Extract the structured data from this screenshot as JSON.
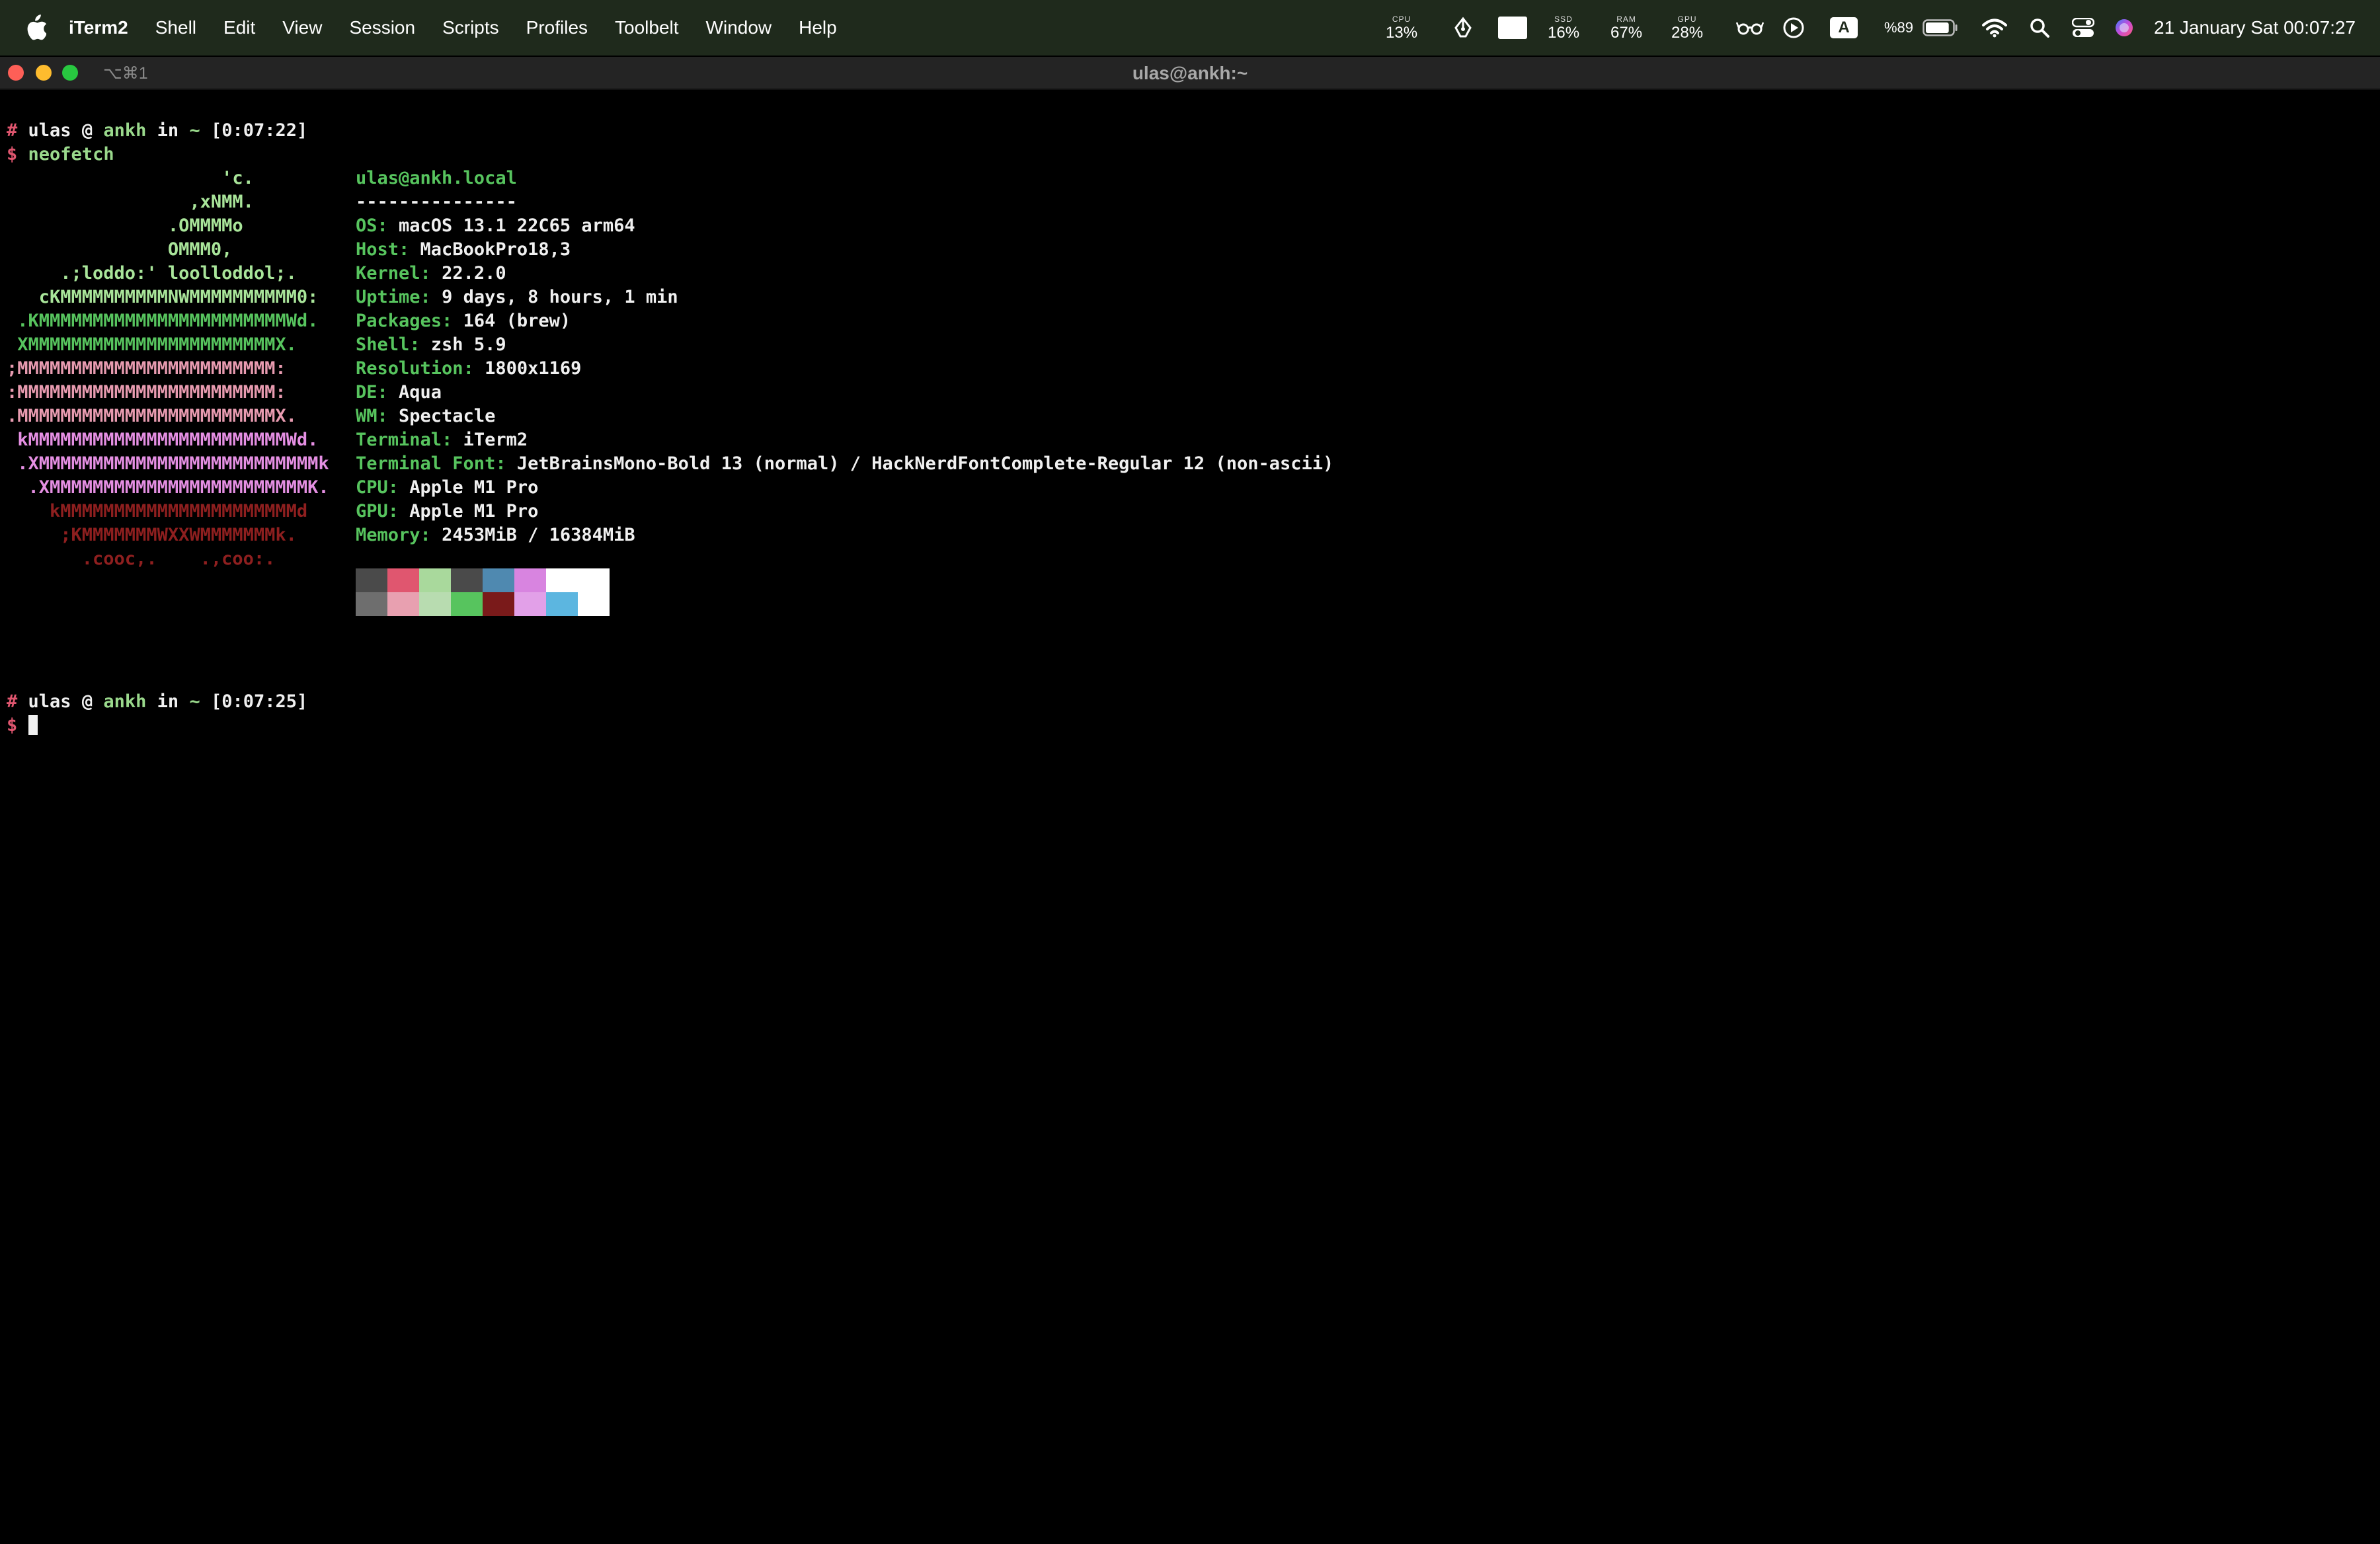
{
  "menubar": {
    "app_name": "iTerm2",
    "menus": [
      "Shell",
      "Edit",
      "View",
      "Session",
      "Scripts",
      "Profiles",
      "Toolbelt",
      "Window",
      "Help"
    ],
    "stats": {
      "cpu": {
        "label": "CPU",
        "value": "13%"
      },
      "ssd": {
        "label": "SSD",
        "value": "16%"
      },
      "ram": {
        "label": "RAM",
        "value": "67%"
      },
      "gpu": {
        "label": "GPU",
        "value": "28%"
      }
    },
    "input_source": "A",
    "battery_text": "%89",
    "battery_level": 0.89,
    "datetime": "21 January Sat  00:07:27"
  },
  "window": {
    "title": "ulas@ankh:~",
    "tab_shortcut": "⌥⌘1",
    "traffic_lights": {
      "close": "#fe5f57",
      "minimize": "#febc2e",
      "zoom": "#28c840"
    }
  },
  "terminal": {
    "prompt1": {
      "hash": "#",
      "user": "ulas",
      "at": "@",
      "host": "ankh",
      "in": "in",
      "dir": "~",
      "time": "[0:07:22]",
      "dollar": "$",
      "command": "neofetch"
    },
    "prompt2": {
      "hash": "#",
      "user": "ulas",
      "at": "@",
      "host": "ankh",
      "in": "in",
      "dir": "~",
      "time": "[0:07:25]",
      "dollar": "$"
    },
    "logo": [
      {
        "text": "                    'c.",
        "color": "#a9e59a"
      },
      {
        "text": "                 ,xNMM.",
        "color": "#a9e59a"
      },
      {
        "text": "               .OMMMMo",
        "color": "#a9e59a"
      },
      {
        "text": "               OMMM0,",
        "color": "#a9e59a"
      },
      {
        "text": "     .;loddo:' loolloddol;.",
        "color": "#a9e59a"
      },
      {
        "text": "   cKMMMMMMMMMMNWMMMMMMMMMM0:",
        "color": "#a9e59a"
      },
      {
        "text": " .KMMMMMMMMMMMMMMMMMMMMMMMWd.",
        "color": "#57c45e"
      },
      {
        "text": " XMMMMMMMMMMMMMMMMMMMMMMMX.",
        "color": "#57c45e"
      },
      {
        "text": ";MMMMMMMMMMMMMMMMMMMMMMMM:",
        "color": "#e89bb0"
      },
      {
        "text": ":MMMMMMMMMMMMMMMMMMMMMMMM:",
        "color": "#e89bb0"
      },
      {
        "text": ".MMMMMMMMMMMMMMMMMMMMMMMMX.",
        "color": "#e89bb0"
      },
      {
        "text": " kMMMMMMMMMMMMMMMMMMMMMMMMWd.",
        "color": "#e58fe3"
      },
      {
        "text": " .XMMMMMMMMMMMMMMMMMMMMMMMMMMk",
        "color": "#e58fe3"
      },
      {
        "text": "  .XMMMMMMMMMMMMMMMMMMMMMMMMK.",
        "color": "#e58fe3"
      },
      {
        "text": "    kMMMMMMMMMMMMMMMMMMMMMMd",
        "color": "#8e1f1f"
      },
      {
        "text": "     ;KMMMMMMMWXXWMMMMMMMk.",
        "color": "#8e1f1f"
      },
      {
        "text": "       .cooc,.    .,coo:.",
        "color": "#8e1f1f"
      }
    ],
    "info_header": "ulas@ankh.local",
    "info_separator": "---------------",
    "info": [
      {
        "key": "OS",
        "value": "macOS 13.1 22C65 arm64"
      },
      {
        "key": "Host",
        "value": "MacBookPro18,3"
      },
      {
        "key": "Kernel",
        "value": "22.2.0"
      },
      {
        "key": "Uptime",
        "value": "9 days, 8 hours, 1 min"
      },
      {
        "key": "Packages",
        "value": "164 (brew)"
      },
      {
        "key": "Shell",
        "value": "zsh 5.9"
      },
      {
        "key": "Resolution",
        "value": "1800x1169"
      },
      {
        "key": "DE",
        "value": "Aqua"
      },
      {
        "key": "WM",
        "value": "Spectacle"
      },
      {
        "key": "Terminal",
        "value": "iTerm2"
      },
      {
        "key": "Terminal Font",
        "value": "JetBrainsMono-Bold 13 (normal) / HackNerdFontComplete-Regular 12 (non-ascii)"
      },
      {
        "key": "CPU",
        "value": "Apple M1 Pro"
      },
      {
        "key": "GPU",
        "value": "Apple M1 Pro"
      },
      {
        "key": "Memory",
        "value": "2453MiB / 16384MiB"
      }
    ],
    "palette_top": [
      "#4a4a4a",
      "#e0566f",
      "#a9d99c",
      "#4a4a4a",
      "#4f89b0",
      "#d884e0",
      "#ffffff",
      "#ffffff"
    ],
    "palette_bottom": [
      "#6e6e6e",
      "#e8a0b0",
      "#b8dcb0",
      "#57c45e",
      "#7a1a1a",
      "#e2a0e8",
      "#5cb6e0",
      "#ffffff"
    ]
  }
}
